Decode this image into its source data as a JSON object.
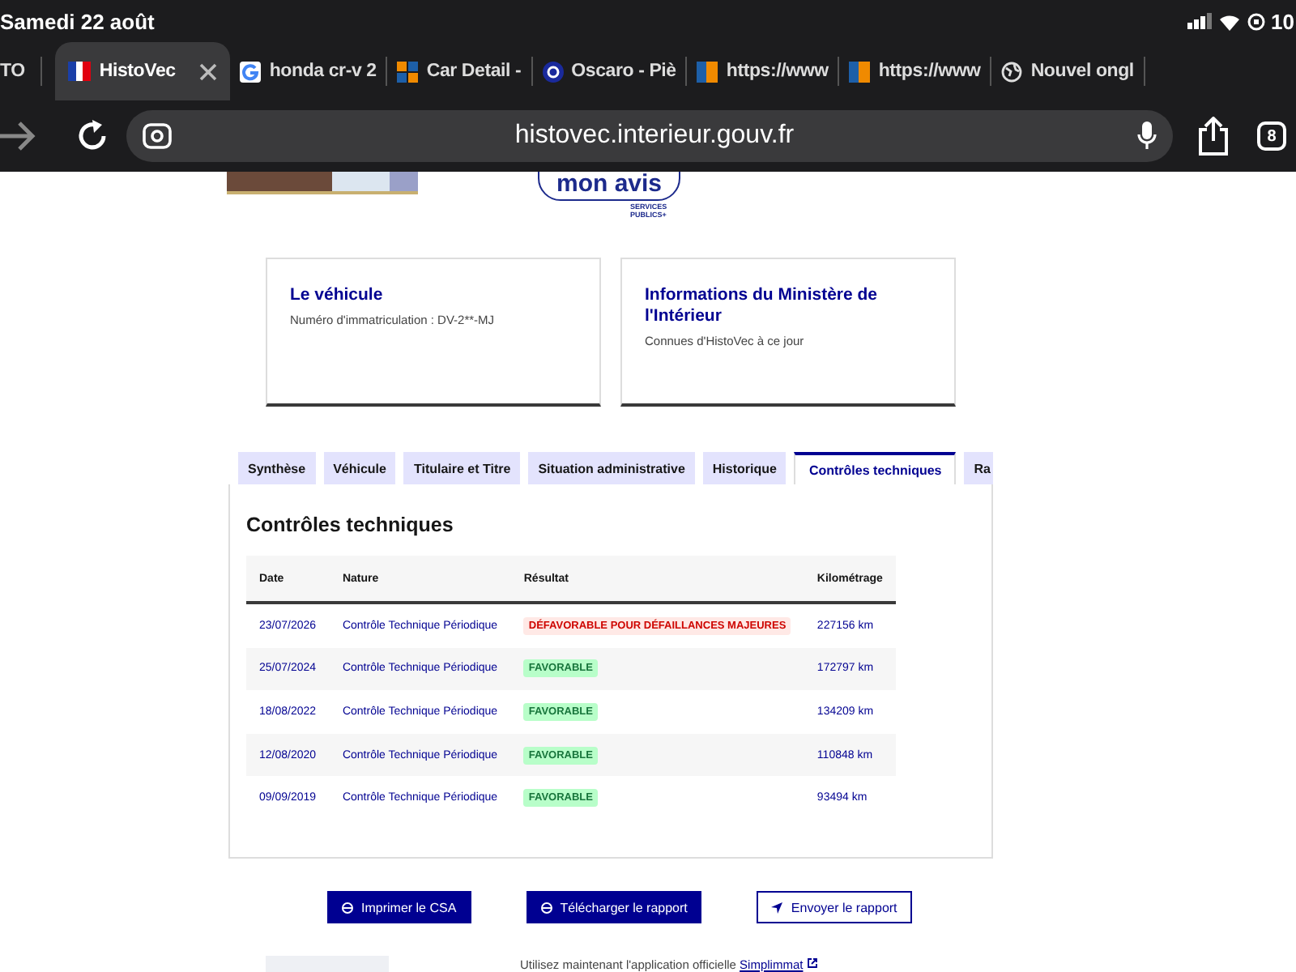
{
  "status_bar": {
    "time": "Samedi 22 août",
    "battery": "10"
  },
  "browser_tabs": [
    {
      "title": "TO",
      "selected": false
    },
    {
      "title": "HistoVec",
      "kind": "flag",
      "selected": true
    },
    {
      "title": "honda cr-v 2",
      "kind": "g",
      "selected": false
    },
    {
      "title": "Car Detail - ",
      "kind": "squares",
      "selected": false
    },
    {
      "title": "Oscaro - Piè",
      "kind": "disc",
      "selected": false
    },
    {
      "title": "https://www",
      "kind": "split",
      "selected": false
    },
    {
      "title": "https://www",
      "kind": "split",
      "selected": false
    },
    {
      "title": "Nouvel ongl",
      "kind": "globe",
      "selected": false
    }
  ],
  "address_bar": {
    "url": "histovec.interieur.gouv.fr",
    "tab_count": "8"
  },
  "feedback_badge": {
    "label": "mon avis",
    "logo": "SERVICES PUBLICS+"
  },
  "cards": [
    {
      "title": "Le véhicule",
      "text": "Numéro d'immatriculation : DV-2**-MJ"
    },
    {
      "title": "Informations du Ministère de l'Intérieur",
      "text": "Connues d'HistoVec à ce jour"
    }
  ],
  "tabs": [
    {
      "label": "Synthèse",
      "selected": false
    },
    {
      "label": "Véhicule",
      "selected": false
    },
    {
      "label": "Titulaire et Titre",
      "selected": false
    },
    {
      "label": "Situation administrative",
      "selected": false
    },
    {
      "label": "Historique",
      "selected": false
    },
    {
      "label": "Contrôles techniques",
      "selected": true
    },
    {
      "label": "Ra",
      "selected": false
    }
  ],
  "panel": {
    "title": "Contrôles techniques",
    "table": {
      "columns": [
        "Date",
        "Nature",
        "Résultat",
        "Kilométrage"
      ],
      "rows": [
        {
          "date": "23/07/2026",
          "nature": "Contrôle Technique Périodique",
          "result": "DÉFAVORABLE POUR DÉFAILLANCES MAJEURES",
          "kind": "unfavorable",
          "mileage": "227156 km"
        },
        {
          "date": "25/07/2024",
          "nature": "Contrôle Technique Périodique",
          "result": "FAVORABLE",
          "kind": "favorable",
          "mileage": "172797 km"
        },
        {
          "date": "18/08/2022",
          "nature": "Contrôle Technique Périodique",
          "result": "FAVORABLE",
          "kind": "favorable",
          "mileage": "134209 km"
        },
        {
          "date": "12/08/2020",
          "nature": "Contrôle Technique Périodique",
          "result": "FAVORABLE",
          "kind": "favorable",
          "mileage": "110848 km"
        },
        {
          "date": "09/09/2019",
          "nature": "Contrôle Technique Périodique",
          "result": "FAVORABLE",
          "kind": "favorable",
          "mileage": "93494 km"
        }
      ]
    }
  },
  "actions": [
    {
      "label": "Imprimer le CSA",
      "kind": "primary"
    },
    {
      "label": "Télécharger le rapport",
      "kind": "primary"
    },
    {
      "label": "Envoyer le rapport",
      "kind": "secondary"
    }
  ],
  "footer": {
    "text": "Utilisez maintenant l'application officielle",
    "link": "Simplimmat"
  }
}
